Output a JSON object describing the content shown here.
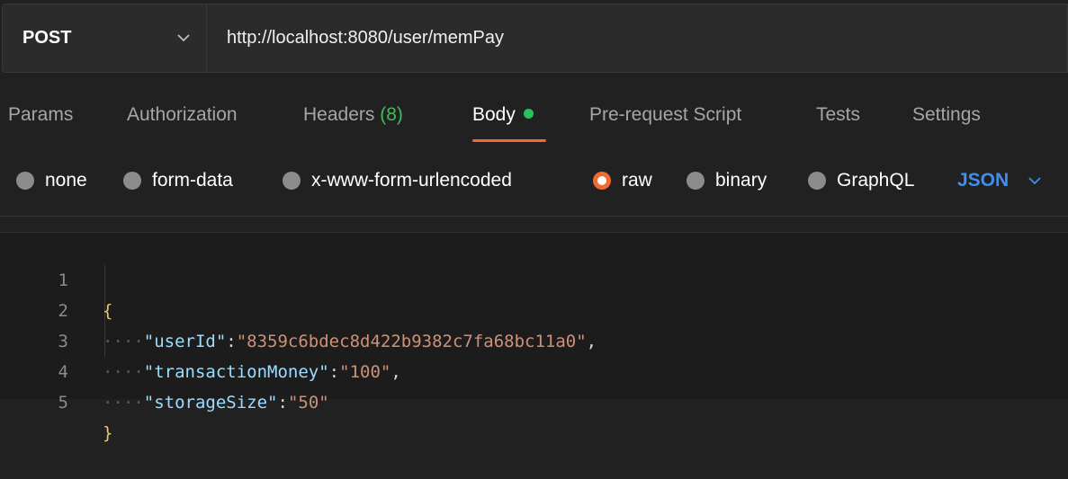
{
  "request": {
    "method": "POST",
    "url": "http://localhost:8080/user/memPay"
  },
  "tabs": [
    {
      "label": "Params"
    },
    {
      "label": "Authorization"
    },
    {
      "label": "Headers",
      "count": "(8)"
    },
    {
      "label": "Body",
      "active": true,
      "indicator": "green-dot"
    },
    {
      "label": "Pre-request Script"
    },
    {
      "label": "Tests"
    },
    {
      "label": "Settings"
    }
  ],
  "body_types": [
    {
      "label": "none",
      "selected": false
    },
    {
      "label": "form-data",
      "selected": false
    },
    {
      "label": "x-www-form-urlencoded",
      "selected": false
    },
    {
      "label": "raw",
      "selected": true
    },
    {
      "label": "binary",
      "selected": false
    },
    {
      "label": "GraphQL",
      "selected": false
    }
  ],
  "format": "JSON",
  "editor": {
    "line_numbers": [
      "1",
      "2",
      "3",
      "4",
      "5"
    ],
    "open_brace": "{",
    "close_brace": "}",
    "indent_dots": "····",
    "fields": [
      {
        "key": "\"userId\"",
        "value": "\"8359c6bdec8d422b9382c7fa68bc11a0\"",
        "trailing": ","
      },
      {
        "key": "\"transactionMoney\"",
        "value": "\"100\"",
        "trailing": ","
      },
      {
        "key": "\"storageSize\"",
        "value": "\"50\"",
        "trailing": ""
      }
    ]
  },
  "colors": {
    "accent": "#f06a35",
    "active_dot": "#28c05a",
    "json_keys": "#9cdcfe",
    "json_strings": "#ce9178",
    "json_format": "#3f8ef0"
  }
}
